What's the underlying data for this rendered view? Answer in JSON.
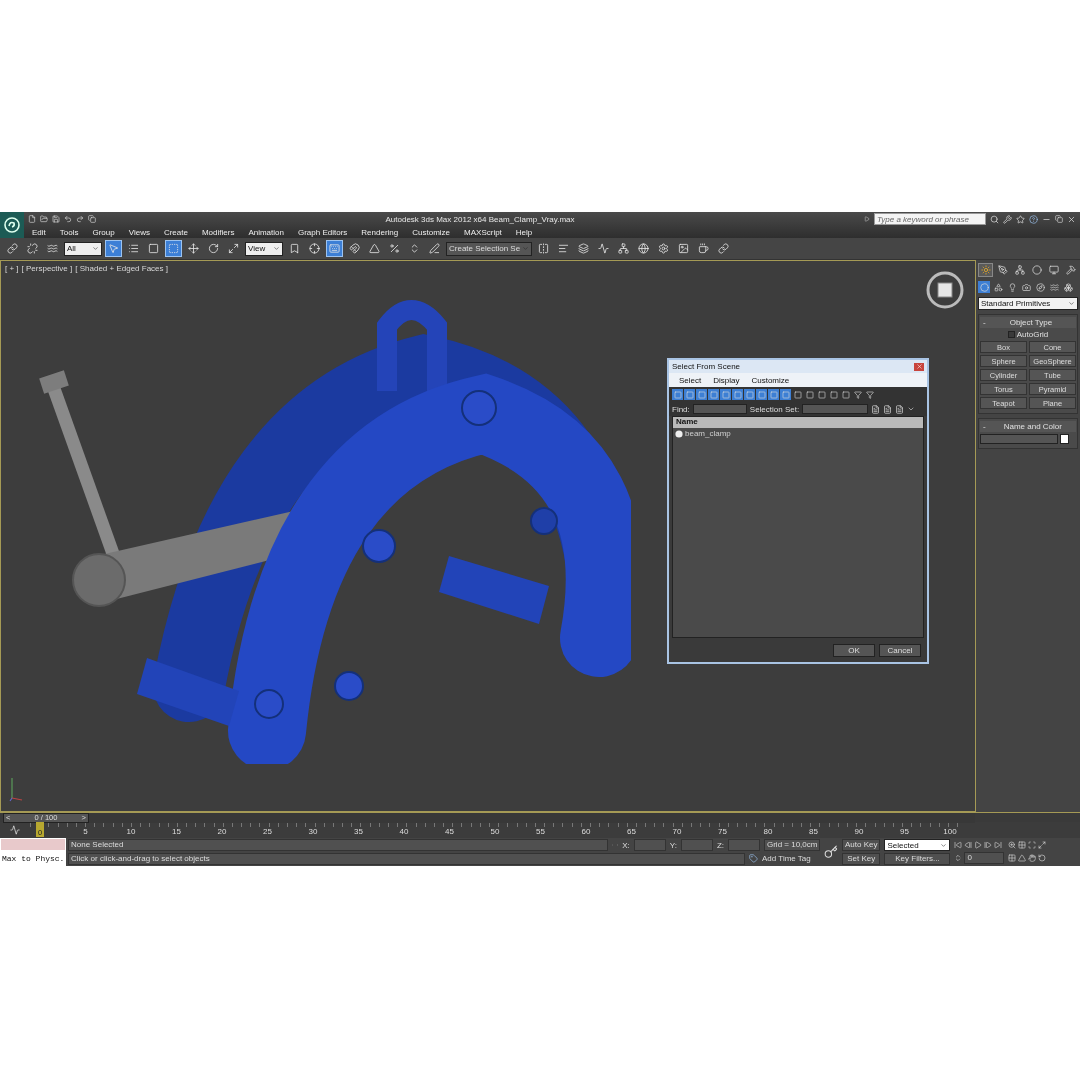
{
  "window": {
    "title": "Autodesk 3ds Max  2012 x64",
    "file": "Beam_Clamp_Vray.max"
  },
  "search": {
    "placeholder": "Type a keyword or phrase"
  },
  "menu": [
    "Edit",
    "Tools",
    "Group",
    "Views",
    "Create",
    "Modifiers",
    "Animation",
    "Graph Editors",
    "Rendering",
    "Customize",
    "MAXScript",
    "Help"
  ],
  "toolbar": [
    {
      "kind": "tool",
      "on": false
    },
    {
      "kind": "tool",
      "on": false
    },
    {
      "kind": "tool",
      "on": false
    },
    {
      "kind": "dropdown",
      "value": "All"
    },
    {
      "kind": "tool",
      "on": true
    },
    {
      "kind": "tool",
      "on": false
    },
    {
      "kind": "tool",
      "on": false
    },
    {
      "kind": "tool",
      "on": true
    },
    {
      "kind": "tool",
      "on": false
    },
    {
      "kind": "tool",
      "on": false
    },
    {
      "kind": "tool",
      "on": false
    },
    {
      "kind": "dropdown",
      "value": "View"
    },
    {
      "kind": "tool",
      "on": false
    },
    {
      "kind": "tool",
      "on": false
    },
    {
      "kind": "tool",
      "on": true
    },
    {
      "kind": "tool",
      "on": false
    },
    {
      "kind": "tool",
      "on": false
    },
    {
      "kind": "tool",
      "on": false
    },
    {
      "kind": "tool",
      "on": false
    },
    {
      "kind": "tool",
      "on": false
    },
    {
      "kind": "dropdown",
      "value": "Create Selection Se"
    },
    {
      "kind": "tool",
      "on": false
    },
    {
      "kind": "tool",
      "on": false
    },
    {
      "kind": "tool",
      "on": false
    },
    {
      "kind": "tool",
      "on": false
    },
    {
      "kind": "tool",
      "on": false
    },
    {
      "kind": "tool",
      "on": false
    },
    {
      "kind": "tool",
      "on": false
    },
    {
      "kind": "tool",
      "on": false
    },
    {
      "kind": "tool",
      "on": false
    },
    {
      "kind": "tool",
      "on": false
    }
  ],
  "viewport": {
    "labels": [
      "[ + ]",
      "[ Perspective ]",
      "[ Shaded + Edged Faces ]"
    ]
  },
  "dialog": {
    "title": "Select From Scene",
    "menu": [
      "Select",
      "Display",
      "Customize"
    ],
    "filters": [
      {
        "on": true
      },
      {
        "on": true
      },
      {
        "on": true
      },
      {
        "on": true
      },
      {
        "on": true
      },
      {
        "on": true
      },
      {
        "on": true
      },
      {
        "on": true
      },
      {
        "on": true
      },
      {
        "on": true
      },
      {
        "on": false
      },
      {
        "on": false
      },
      {
        "on": false
      },
      {
        "on": false
      },
      {
        "on": false
      },
      {
        "on": false
      },
      {
        "on": false
      }
    ],
    "find_label": "Find:",
    "selection_set_label": "Selection Set:",
    "column": "Name",
    "rows": [
      {
        "name": "beam_clamp",
        "selected": false
      }
    ],
    "buttons": [
      "OK",
      "Cancel"
    ]
  },
  "command_panel": {
    "tabs": [
      {
        "selected": true
      },
      {
        "selected": false
      },
      {
        "selected": false
      },
      {
        "selected": false
      },
      {
        "selected": false
      },
      {
        "selected": false
      }
    ],
    "categories": [
      {
        "selected": true
      },
      {
        "selected": false
      },
      {
        "selected": false
      },
      {
        "selected": false
      },
      {
        "selected": false
      },
      {
        "selected": false
      },
      {
        "selected": false
      }
    ],
    "dropdown": "Standard Primitives",
    "object_type": {
      "toggle": "-",
      "title": "Object Type",
      "autogrid": {
        "label": "AutoGrid",
        "checked": false
      },
      "buttons": [
        "Box",
        "Cone",
        "Sphere",
        "GeoSphere",
        "Cylinder",
        "Tube",
        "Torus",
        "Pyramid",
        "Teapot",
        "Plane"
      ]
    },
    "name_color": {
      "toggle": "-",
      "title": "Name and Color",
      "color": "#ffffff"
    }
  },
  "time_slider": {
    "prev": "<",
    "frame": "0 / 100",
    "next": ">",
    "level": 0
  },
  "trackbar": {
    "current": "0",
    "ticks": [
      "5",
      "10",
      "15",
      "20",
      "25",
      "30",
      "35",
      "40",
      "45",
      "50",
      "55",
      "60",
      "65",
      "70",
      "75",
      "80",
      "85",
      "90",
      "95",
      "100"
    ]
  },
  "status": {
    "listener": "Max to Physc.",
    "selection": "None Selected",
    "prompt": "Click or click-and-drag to select objects",
    "x_label": "X:",
    "y_label": "Y:",
    "z_label": "Z:",
    "grid": "Grid = 10,0cm",
    "add_time_tag": "Add Time Tag",
    "auto_key": "Auto Key",
    "set_key": "Set Key",
    "key_mode": "Selected",
    "key_filters": "Key Filters...",
    "frame": "0"
  }
}
